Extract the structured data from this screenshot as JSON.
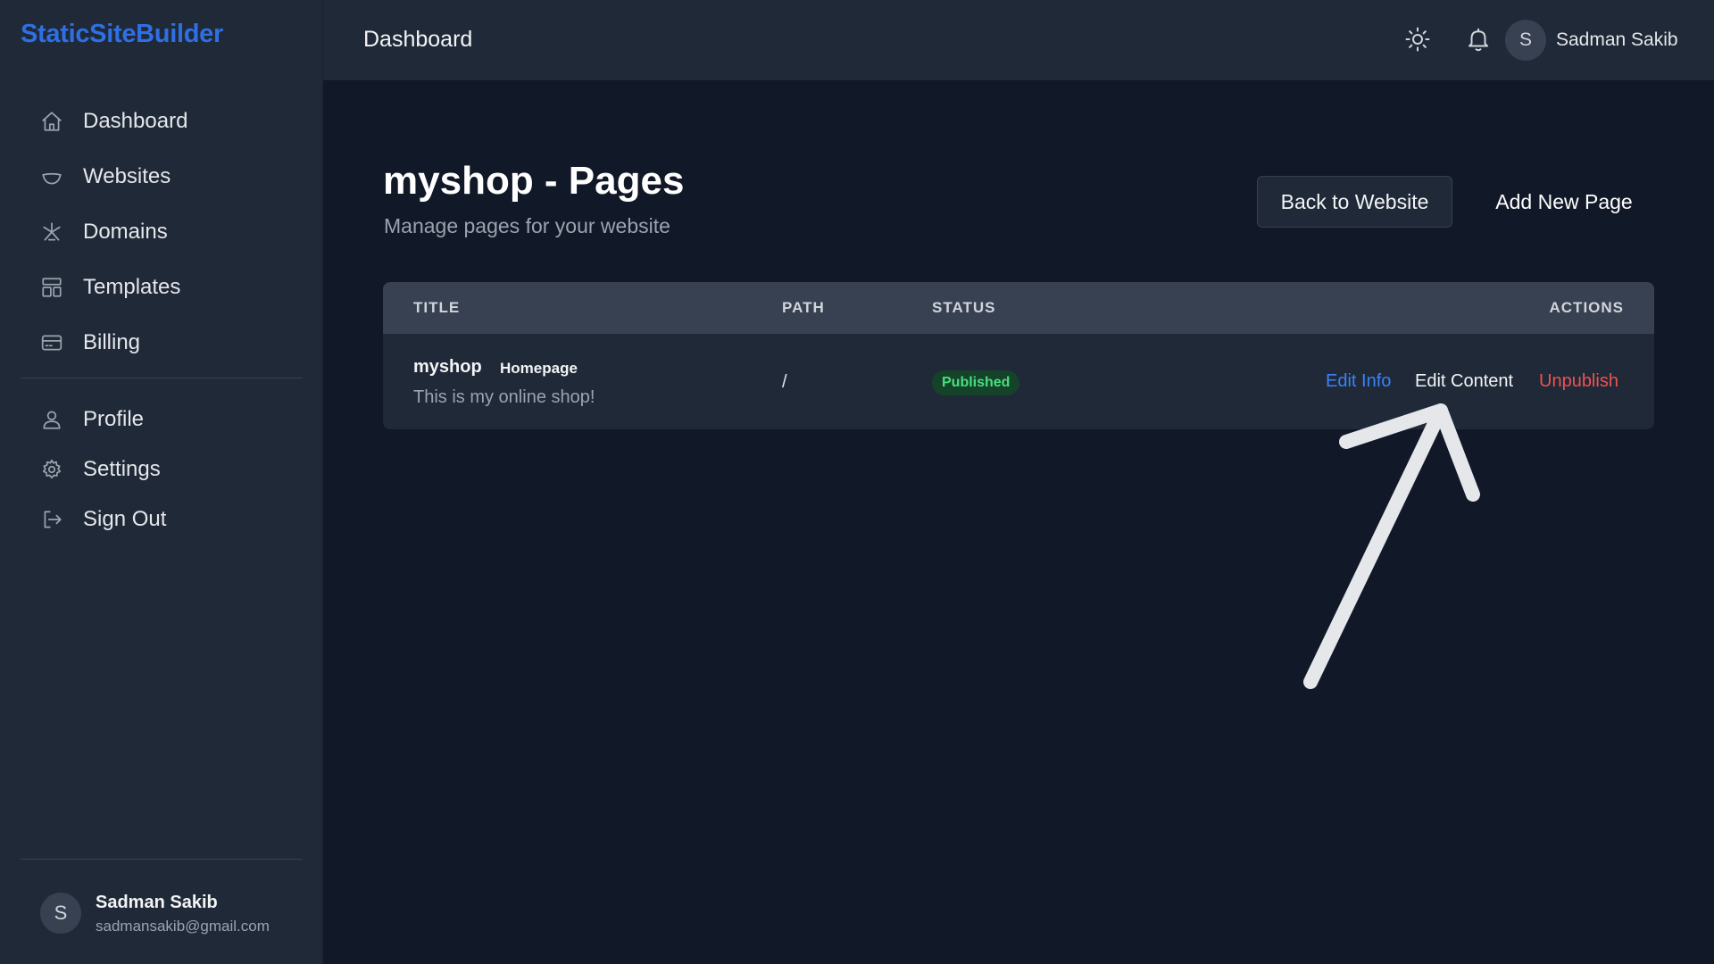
{
  "sidebar": {
    "brand": "StaticSiteBuilder",
    "items": [
      {
        "label": "Dashboard",
        "icon": "home-icon"
      },
      {
        "label": "Websites",
        "icon": "bowl-icon"
      },
      {
        "label": "Domains",
        "icon": "network-icon"
      },
      {
        "label": "Templates",
        "icon": "layout-icon"
      },
      {
        "label": "Billing",
        "icon": "credit-card-icon"
      }
    ],
    "secondary_items": [
      {
        "label": "Profile",
        "icon": "user-icon"
      },
      {
        "label": "Settings",
        "icon": "gear-icon"
      },
      {
        "label": "Sign Out",
        "icon": "sign-out-icon"
      }
    ],
    "user": {
      "initial": "S",
      "name": "Sadman Sakib",
      "email": "sadmansakib@gmail.com"
    }
  },
  "header": {
    "title": "Dashboard",
    "theme_icon": "sun-icon",
    "notification_icon": "bell-icon",
    "user": {
      "initial": "S",
      "name": "Sadman Sakib"
    }
  },
  "main": {
    "title": "myshop - Pages",
    "subtitle": "Manage pages for your website",
    "back_button": "Back to Website",
    "add_button": "Add New Page",
    "table": {
      "columns": [
        "TITLE",
        "PATH",
        "STATUS",
        "ACTIONS"
      ],
      "rows": [
        {
          "title": "myshop",
          "badge": "Homepage",
          "description": "This is my online shop!",
          "path": "/",
          "status": "Published",
          "actions": {
            "edit_info": "Edit Info",
            "edit_content": "Edit Content",
            "unpublish": "Unpublish"
          }
        }
      ]
    }
  },
  "colors": {
    "brand": "#2f6fe4",
    "status_published": "#4ade80",
    "link_blue": "#3b82f6",
    "danger": "#f05252"
  }
}
